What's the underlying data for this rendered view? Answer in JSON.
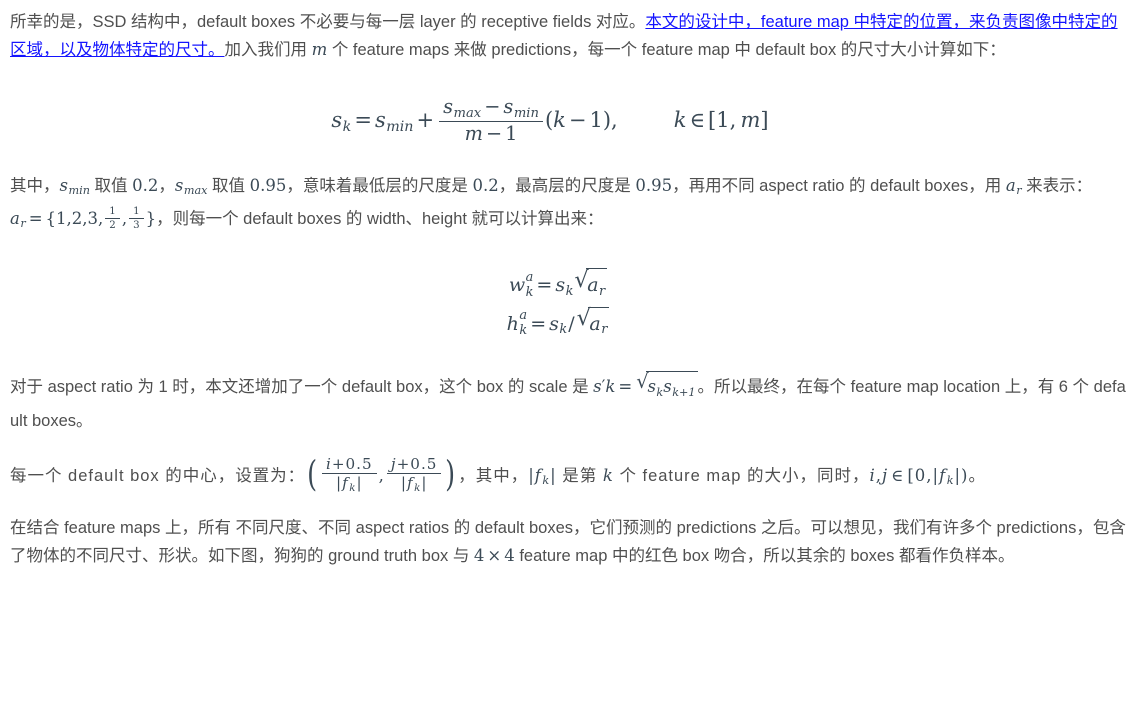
{
  "document": {
    "language": "zh-CN",
    "topic": "SSD default boxes scale and aspect ratio",
    "colors": {
      "body_text": "#4f4f4f",
      "link": "#1414ff",
      "math": "#3b4a56",
      "background": "#ffffff"
    }
  },
  "paragraphs": {
    "p1": {
      "seg1": "所幸的是，SSD 结构中，default boxes 不必要与每一层 layer 的 receptive fields 对应。",
      "link": "本文的设计中，feature map 中特定的位置，来负责图像中特定的区域，以及物体特定的尺寸。",
      "seg2": "加入我们用 ",
      "math_m": "m",
      "seg3": " 个 feature maps 来做 predictions，每一个 feature map 中 default box 的尺寸大小计算如下："
    },
    "p2": {
      "seg1": "其中，",
      "math_smin": "s_min",
      "seg2": " 取值 ",
      "val_smin": "0.2",
      "seg3": "，",
      "math_smax": "s_max",
      "seg4": " 取值 ",
      "val_smax": "0.95",
      "seg5": "，意味着最低层的尺度是 ",
      "val_low": "0.2",
      "seg6": "，最高层的尺度是 ",
      "val_high": "0.95",
      "seg7": "，再用不同 aspect ratio 的 default boxes，用 ",
      "math_ar": "a_r",
      "seg8": " 来表示：",
      "math_ar_set": "a_r = {1,2,3,1/2,1/3}",
      "seg9": "，则每一个 default boxes 的 width、height 就可以计算出来："
    },
    "p3": {
      "seg1": "对于 aspect ratio 为 1 时，本文还增加了一个 default box，这个 box 的 scale 是 ",
      "math_sprime": "s'k = sqrt(s_k * s_{k+1})",
      "seg2": "。所以最终，在每个 feature map location 上，有 6 个 default boxes。"
    },
    "p4": {
      "seg1": "每一个 default box 的中心，设置为：",
      "math_center": "((i+0.5)/|f_k|, (j+0.5)/|f_k|)",
      "seg2": "，其中，",
      "math_fk": "|f_k|",
      "seg3": " 是第 ",
      "math_k": "k",
      "seg4": " 个 feature map 的大小，同时，",
      "math_ij": "i,j ∈ [0,|f_k|)",
      "seg5": "。"
    },
    "p5": {
      "seg1": "在结合 feature maps 上，所有 不同尺度、不同 aspect ratios 的 default boxes，它们预测的 predictions 之后。可以想见，我们有许多个 predictions，包含了物体的不同尺寸、形状。如下图，狗狗的 ground truth box 与 ",
      "math_4x4": "4 × 4",
      "seg2": " feature map 中的红色 box 吻合，所以其余的 boxes 都看作负样本。"
    }
  },
  "equations": {
    "eq1": {
      "id": "scale-formula",
      "latex": "s_k = s_{min} + \\frac{s_{max} - s_{min}}{m-1}(k-1), \\quad k \\in [1,m]",
      "parts": {
        "lhs": "s_k",
        "eq": "=",
        "smin": "s_min",
        "plus": "+",
        "num": "s_max − s_min",
        "den": "m − 1",
        "tail": "(k − 1),",
        "cond": "k ∈ [1, m]"
      }
    },
    "eq2": {
      "id": "width-height-formula",
      "latex": "w_k^a = s_k\\sqrt{a_r} \\\\ h_k^a = s_k/\\sqrt{a_r}",
      "parts": {
        "line1": "w_k^a = s_k √(a_r)",
        "line2": "h_k^a = s_k / √(a_r)"
      }
    }
  }
}
